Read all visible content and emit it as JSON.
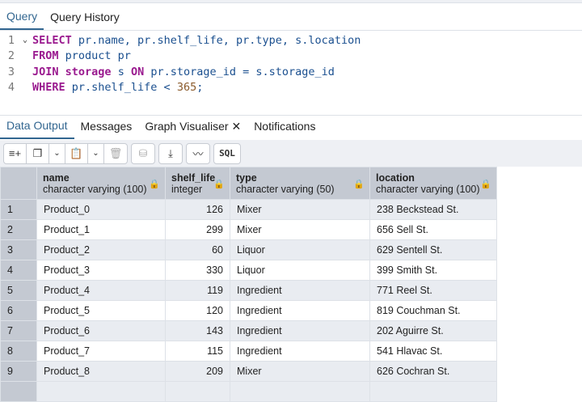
{
  "query_tabs": [
    "Query",
    "Query History"
  ],
  "editor": {
    "lines": [
      {
        "n": "1",
        "parts": [
          [
            "kw",
            "SELECT"
          ],
          [
            "c",
            " pr.name, pr.shelf_life, pr.type, s.location"
          ]
        ]
      },
      {
        "n": "2",
        "parts": [
          [
            "kw",
            "FROM"
          ],
          [
            "c",
            " product pr"
          ]
        ]
      },
      {
        "n": "3",
        "parts": [
          [
            "kw",
            "JOIN"
          ],
          [
            "c",
            " "
          ],
          [
            "kw",
            "storage"
          ],
          [
            "c",
            " s "
          ],
          [
            "kw",
            "ON"
          ],
          [
            "c",
            " pr.storage_id = s.storage_id"
          ]
        ]
      },
      {
        "n": "4",
        "parts": [
          [
            "kw",
            "WHERE"
          ],
          [
            "c",
            " pr.shelf_life < "
          ],
          [
            "num",
            "365"
          ],
          [
            "c",
            ";"
          ]
        ]
      }
    ]
  },
  "output_tabs": [
    "Data Output",
    "Messages",
    "Graph Visualiser",
    "Notifications"
  ],
  "toolbar": {
    "sql_label": "SQL"
  },
  "columns": [
    {
      "name": "name",
      "type": "character varying (100)"
    },
    {
      "name": "shelf_life",
      "type": "integer"
    },
    {
      "name": "type",
      "type": "character varying (50)"
    },
    {
      "name": "location",
      "type": "character varying (100)"
    }
  ],
  "rows": [
    [
      "1",
      "Product_0",
      "126",
      "Mixer",
      "238 Beckstead St."
    ],
    [
      "2",
      "Product_1",
      "299",
      "Mixer",
      "656 Sell St."
    ],
    [
      "3",
      "Product_2",
      "60",
      "Liquor",
      "629 Sentell St."
    ],
    [
      "4",
      "Product_3",
      "330",
      "Liquor",
      "399 Smith St."
    ],
    [
      "5",
      "Product_4",
      "119",
      "Ingredient",
      "771 Reel St."
    ],
    [
      "6",
      "Product_5",
      "120",
      "Ingredient",
      "819 Couchman St."
    ],
    [
      "7",
      "Product_6",
      "143",
      "Ingredient",
      "202 Aguirre St."
    ],
    [
      "8",
      "Product_7",
      "115",
      "Ingredient",
      "541 Hlavac St."
    ],
    [
      "9",
      "Product_8",
      "209",
      "Mixer",
      "626 Cochran St."
    ]
  ]
}
